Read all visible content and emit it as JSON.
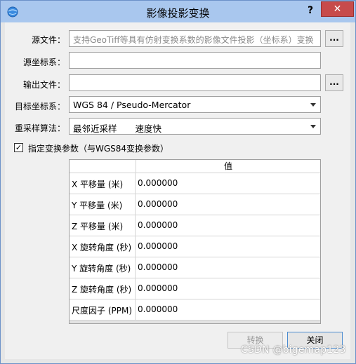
{
  "window": {
    "title": "影像投影变换",
    "help_label": "?",
    "close_label": "✕"
  },
  "form": {
    "source_file": {
      "label": "源文件：",
      "value": "",
      "placeholder": "支持GeoTiff等具有仿射变换系数的影像文件投影（坐标系）变换",
      "browse_label": "..."
    },
    "source_crs": {
      "label": "源坐标系：",
      "value": ""
    },
    "output_file": {
      "label": "输出文件：",
      "value": "",
      "browse_label": "..."
    },
    "target_crs": {
      "label": "目标坐标系：",
      "selected": "WGS 84 / Pseudo-Mercator"
    },
    "resample": {
      "label": "重采样算法：",
      "selected": "最邻近采样",
      "note": "速度快"
    },
    "transform_params": {
      "checked": true,
      "check_mark": "✓",
      "label": "指定变换参数（与WGS84变换参数）"
    }
  },
  "params_table": {
    "header": "值",
    "rows": [
      {
        "name": "X 平移量 (米)",
        "value": "0.000000"
      },
      {
        "name": "Y 平移量 (米)",
        "value": "0.000000"
      },
      {
        "name": "Z 平移量 (米)",
        "value": "0.000000"
      },
      {
        "name": "X 旋转角度 (秒)",
        "value": "0.000000"
      },
      {
        "name": "Y 旋转角度 (秒)",
        "value": "0.000000"
      },
      {
        "name": "Z 旋转角度 (秒)",
        "value": "0.000000"
      },
      {
        "name": "尺度因子 (PPM)",
        "value": "0.000000"
      }
    ]
  },
  "buttons": {
    "convert": "转换",
    "close": "关闭"
  },
  "watermark": "CSDN @bigemap123",
  "colors": {
    "titlebar": "#a9c7ee",
    "close_button": "#c74b4b",
    "dialog_bg": "#f0f0f0"
  }
}
